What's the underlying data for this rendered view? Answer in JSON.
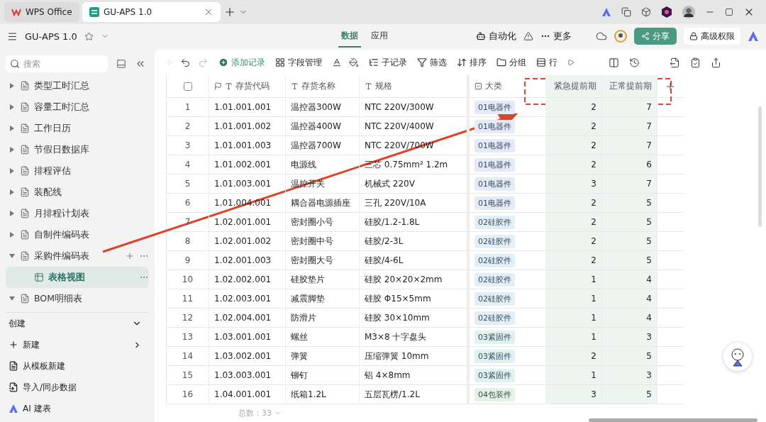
{
  "browser_tabs": [
    {
      "label": "WPS Office",
      "selected": false
    },
    {
      "label": "GU-APS 1.0",
      "selected": true
    }
  ],
  "app_bar": {
    "title": "GU-APS 1.0",
    "tabs": [
      {
        "label": "数据",
        "selected": true
      },
      {
        "label": "应用",
        "selected": false
      }
    ],
    "automation": "自动化",
    "more": "更多",
    "share": "分享",
    "permissions": "高级权限"
  },
  "sidebar": {
    "search": {
      "placeholder": "搜索"
    },
    "items": [
      {
        "label": "类型工时汇总",
        "kind": "table",
        "expanded": false
      },
      {
        "label": "容量工时汇总",
        "kind": "table",
        "expanded": false
      },
      {
        "label": "工作日历",
        "kind": "table",
        "expanded": false
      },
      {
        "label": "节假日数据库",
        "kind": "table",
        "expanded": false
      },
      {
        "label": "排程评估",
        "kind": "table",
        "expanded": false
      },
      {
        "label": "装配线",
        "kind": "table",
        "expanded": false
      },
      {
        "label": "月排程计划表",
        "kind": "table",
        "expanded": false
      },
      {
        "label": "自制件编码表",
        "kind": "table",
        "expanded": false
      },
      {
        "label": "采购件编码表",
        "kind": "table",
        "expanded": true,
        "children": [
          {
            "label": "表格视图",
            "kind": "view",
            "selected": true
          }
        ]
      },
      {
        "label": "BOM明细表",
        "kind": "table",
        "expanded": true
      }
    ],
    "create": {
      "title": "创建",
      "items": [
        "新建",
        "从模板新建",
        "导入/同步数据",
        "AI 建表"
      ]
    }
  },
  "toolbar": [
    "添加记录",
    "字段管理",
    "子记录",
    "筛选",
    "排序",
    "分组",
    "行"
  ],
  "table": {
    "select_all": {
      "checked": false
    },
    "columns": [
      "存货代码",
      "存货名称",
      "规格",
      "大类",
      "紧急提前期",
      "正常提前期"
    ],
    "rows": [
      {
        "index": "1",
        "code": "1.01.001.001",
        "name": "温控器300W",
        "spec": "NTC 220V/300W",
        "category": {
          "label": "01电器件",
          "color": "#e4eaf8"
        },
        "urgent": "2",
        "normal": "7"
      },
      {
        "index": "2",
        "code": "1.01.001.002",
        "name": "温控器400W",
        "spec": "NTC 220V/400W",
        "category": {
          "label": "01电器件",
          "color": "#e4eaf8"
        },
        "urgent": "2",
        "normal": "7"
      },
      {
        "index": "3",
        "code": "1.01.001.003",
        "name": "温控器700W",
        "spec": "NTC 220V/700W",
        "category": {
          "label": "01电器件",
          "color": "#e4eaf8"
        },
        "urgent": "2",
        "normal": "7"
      },
      {
        "index": "4",
        "code": "1.01.002.001",
        "name": "电源线",
        "spec": "三芯 0.75mm² 1.2m",
        "category": {
          "label": "01电器件",
          "color": "#e4eaf8"
        },
        "urgent": "2",
        "normal": "6"
      },
      {
        "index": "5",
        "code": "1.01.003.001",
        "name": "温控开关",
        "spec": "机械式 220V",
        "category": {
          "label": "01电器件",
          "color": "#e4eaf8"
        },
        "urgent": "3",
        "normal": "7"
      },
      {
        "index": "6",
        "code": "1.01.004.001",
        "name": "耦合器电源插座",
        "spec": "三孔 220V/10A",
        "category": {
          "label": "01电器件",
          "color": "#e4eaf8"
        },
        "urgent": "2",
        "normal": "5"
      },
      {
        "index": "7",
        "code": "1.02.001.001",
        "name": "密封圈小号",
        "spec": "硅胶/1.2-1.8L",
        "category": {
          "label": "02硅胶件",
          "color": "#e2eff8"
        },
        "urgent": "2",
        "normal": "5"
      },
      {
        "index": "8",
        "code": "1.02.001.002",
        "name": "密封圈中号",
        "spec": "硅胶/2-3L",
        "category": {
          "label": "02硅胶件",
          "color": "#e2eff8"
        },
        "urgent": "2",
        "normal": "5"
      },
      {
        "index": "9",
        "code": "1.02.001.003",
        "name": "密封圈大号",
        "spec": "硅胶/4-6L",
        "category": {
          "label": "02硅胶件",
          "color": "#e2eff8"
        },
        "urgent": "2",
        "normal": "5"
      },
      {
        "index": "10",
        "code": "1.02.002.001",
        "name": "硅胶垫片",
        "spec": "硅胶 20×20×2mm",
        "category": {
          "label": "02硅胶件",
          "color": "#e2eff8"
        },
        "urgent": "1",
        "normal": "4"
      },
      {
        "index": "11",
        "code": "1.02.003.001",
        "name": "减震脚垫",
        "spec": "硅胶 Φ15×5mm",
        "category": {
          "label": "02硅胶件",
          "color": "#e2eff8"
        },
        "urgent": "1",
        "normal": "4"
      },
      {
        "index": "12",
        "code": "1.02.004.001",
        "name": "防滑片",
        "spec": "硅胶 30×10mm",
        "category": {
          "label": "02硅胶件",
          "color": "#e2eff8"
        },
        "urgent": "1",
        "normal": "4"
      },
      {
        "index": "13",
        "code": "1.03.001.001",
        "name": "螺丝",
        "spec": "M3×8 十字盘头",
        "category": {
          "label": "03紧固件",
          "color": "#e0f1f1"
        },
        "urgent": "1",
        "normal": "3"
      },
      {
        "index": "14",
        "code": "1.03.002.001",
        "name": "弹簧",
        "spec": "压缩弹簧 10mm",
        "category": {
          "label": "03紧固件",
          "color": "#e0f1f1"
        },
        "urgent": "2",
        "normal": "5"
      },
      {
        "index": "15",
        "code": "1.03.003.001",
        "name": "铆钉",
        "spec": "铝 4×8mm",
        "category": {
          "label": "03紧固件",
          "color": "#e0f1f1"
        },
        "urgent": "1",
        "normal": "3"
      },
      {
        "index": "16",
        "code": "1.04.001.001",
        "name": "纸箱1.2L",
        "spec": "五层瓦楞/1.2L",
        "category": {
          "label": "04包装件",
          "color": "#e3f3e2"
        },
        "urgent": "3",
        "normal": "5"
      }
    ],
    "total": "总数：33"
  }
}
